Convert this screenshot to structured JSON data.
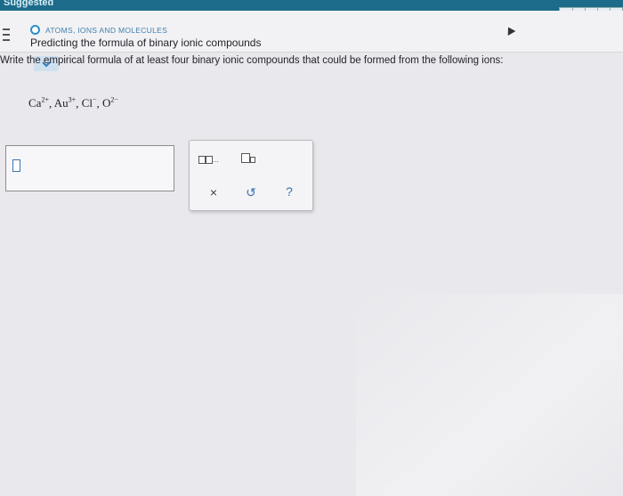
{
  "header": {
    "strip_text": "Suggested",
    "topic": "ATOMS, IONS AND MOLECULES",
    "title": "Predicting the formula of binary ionic compounds"
  },
  "question": {
    "instruction": "Write the empirical formula of at least four binary ionic compounds that could be formed from the following ions:",
    "ions": [
      {
        "symbol": "Ca",
        "charge": "2+"
      },
      {
        "symbol": "Au",
        "charge": "3+"
      },
      {
        "symbol": "Cl",
        "charge": "−"
      },
      {
        "symbol": "O",
        "charge": "2−"
      }
    ]
  },
  "answer": {
    "value": ""
  },
  "palette": {
    "tools": [
      "sequence-tool",
      "subscript-tool"
    ],
    "buttons": {
      "clear": "×",
      "undo": "↺",
      "help": "?"
    }
  },
  "colors": {
    "accent": "#2f8fc9",
    "topic_text": "#3f7fae",
    "expand_button": "#cfe1ef"
  }
}
